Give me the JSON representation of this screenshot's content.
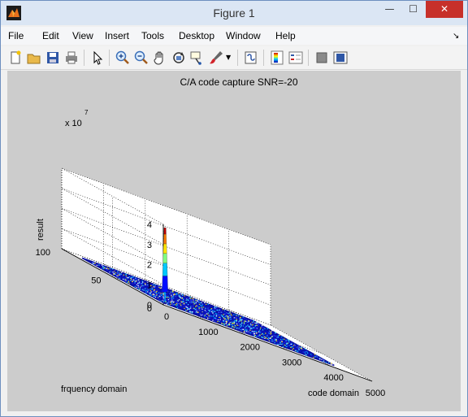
{
  "window": {
    "title": "Figure 1",
    "minimize_icon": "minimize-icon",
    "maximize_icon": "maximize-icon",
    "close_icon": "close-icon"
  },
  "menubar": {
    "items": [
      "File",
      "Edit",
      "View",
      "Insert",
      "Tools",
      "Desktop",
      "Window",
      "Help"
    ]
  },
  "toolbar": {
    "icons": [
      "new-figure-icon",
      "open-file-icon",
      "save-icon",
      "print-icon",
      "edit-plot-icon",
      "zoom-in-icon",
      "zoom-out-icon",
      "pan-icon",
      "rotate-3d-icon",
      "data-cursor-icon",
      "brush-icon",
      "link-plot-icon",
      "colorbar-icon",
      "legend-icon",
      "hide-plot-tools-icon",
      "show-plot-tools-icon"
    ]
  },
  "chart_data": {
    "type": "surface",
    "title": "C/A code capture SNR=-20",
    "xlabel": "code domain",
    "ylabel": "frquency domain",
    "zlabel": "result",
    "z_exponent_label": "x 10",
    "z_exponent": "7",
    "xlim": [
      0,
      5000
    ],
    "ylim": [
      0,
      100
    ],
    "zlim": [
      0,
      4
    ],
    "x_ticks": [
      "0",
      "1000",
      "2000",
      "3000",
      "4000",
      "5000"
    ],
    "y_ticks": [
      "0",
      "50",
      "100"
    ],
    "z_ticks": [
      "0",
      "1",
      "2",
      "3",
      "4"
    ],
    "x_extent": [
      0,
      4092
    ],
    "y_extent": [
      0,
      80
    ],
    "noise_floor": 0.1,
    "peak": {
      "x": 1500,
      "y": 60,
      "z": 3.3
    },
    "grid": true,
    "colormap": "jet"
  }
}
